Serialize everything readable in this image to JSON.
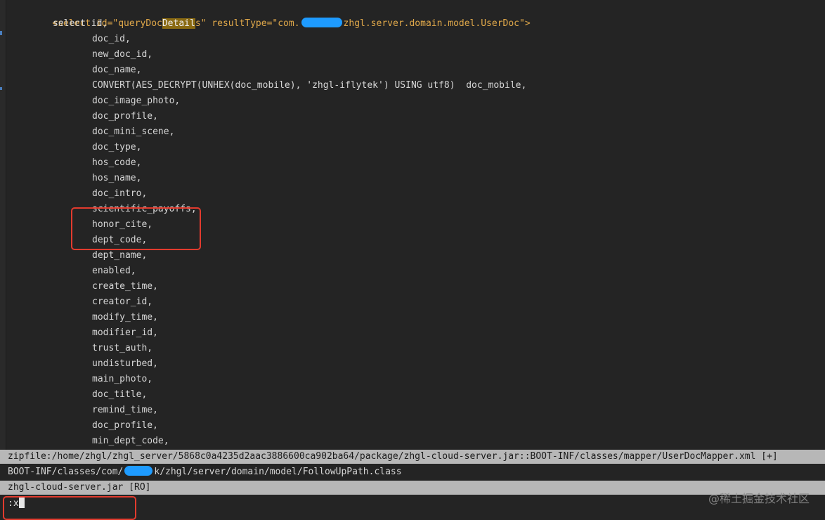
{
  "code": {
    "select_open": {
      "prefix": "<select id=\"queryDoc",
      "highlight": "Detail",
      "mid": "s\" resultType=\"com.",
      "suffix": "zhgl.server.domain.model.UserDoc\">"
    },
    "select_kw": "select id,",
    "columns": [
      "doc_id,",
      "new_doc_id,",
      "doc_name,",
      "CONVERT(AES_DECRYPT(UNHEX(doc_mobile), 'zhgl-iflytek') USING utf8)  doc_mobile,",
      "doc_image_photo,",
      "doc_profile,",
      "doc_mini_scene,",
      "doc_type,",
      "hos_code,",
      "hos_name,",
      "doc_intro,",
      "scientific_payoffs,",
      "honor_cite,",
      "dept_code,",
      "dept_name,",
      "enabled,",
      "create_time,",
      "creator_id,",
      "modify_time,",
      "modifier_id,",
      "trust_auth,",
      "undisturbed,",
      "main_photo,",
      "doc_title,",
      "remind_time,",
      "doc_profile,",
      "min_dept_code,"
    ]
  },
  "status": {
    "zipfile": "zipfile:/home/zhgl/zhgl_server/5868c0a4235d2aac3886600ca902ba64/package/zhgl-cloud-server.jar::BOOT-INF/classes/mapper/UserDocMapper.xml [+]",
    "class_path_prefix": "BOOT-INF/classes/com/",
    "class_path_suffix": "k/zhgl/server/domain/model/FollowUpPath.class",
    "jar": "zhgl-cloud-server.jar [RO]"
  },
  "command": ":x",
  "watermark": "@稀土掘金技术社区",
  "colors": {
    "background": "#242424",
    "annotation": "#e23b2e",
    "redaction": "#1e9bff",
    "status_bar": "#b7b7b7"
  }
}
